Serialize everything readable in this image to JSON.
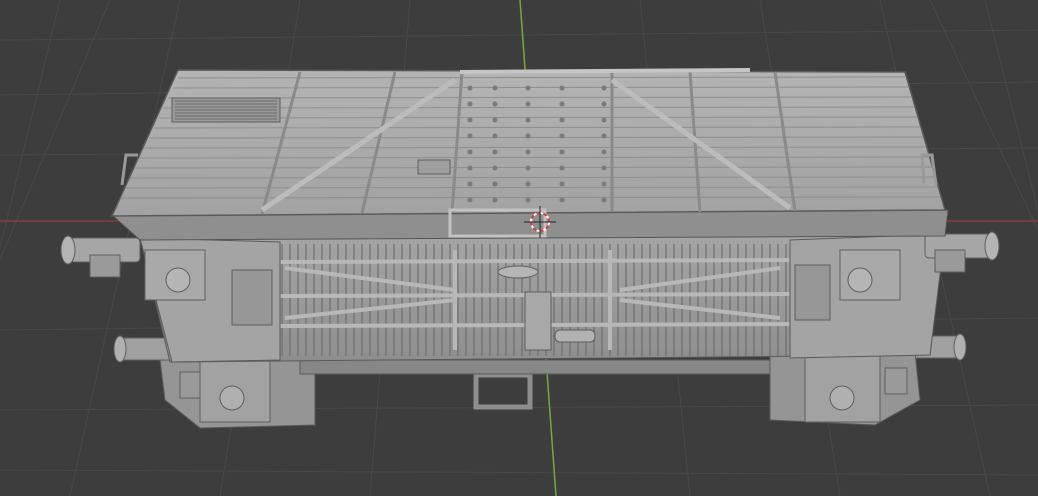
{
  "viewport": {
    "background_color": "#3d3d3d",
    "grid_color": "#4a4a4a",
    "x_axis_color": "#8a3b3b",
    "y_axis_color": "#7da63a",
    "cursor_icon": "3d-cursor-icon"
  },
  "model": {
    "icon": "boxcar-model-icon",
    "base_color": "#9a9a9a",
    "light_color": "#b2b2b2",
    "dark_color": "#6c6c6c",
    "shadow_color": "#575757"
  }
}
